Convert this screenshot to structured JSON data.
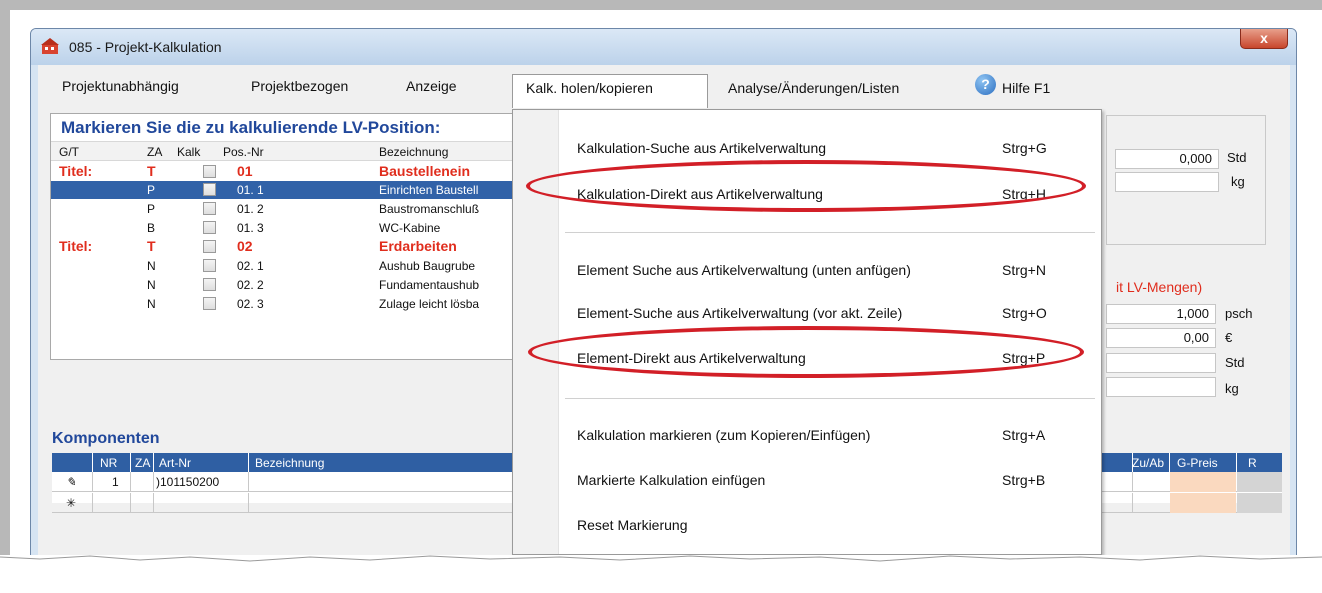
{
  "window": {
    "title": "085  -  Projekt-Kalkulation",
    "close_label": "x"
  },
  "menubar": {
    "items": [
      {
        "label": "Projektunabhängig"
      },
      {
        "label": "Projektbezogen"
      },
      {
        "label": "Anzeige"
      },
      {
        "label": "Kalk. holen/kopieren"
      },
      {
        "label": "Analyse/Änderungen/Listen"
      },
      {
        "label": "Hilfe F1"
      }
    ],
    "active_index": 3
  },
  "lv_panel": {
    "heading": "Markieren Sie die zu kalkulierende LV-Position:",
    "headers": [
      "G/T",
      "ZA",
      "Kalk",
      "Pos.-Nr",
      "Bezeichnung"
    ],
    "rows": [
      {
        "gt": "Titel:",
        "za": "T",
        "pos": "01",
        "bez": "Baustellenein",
        "title": true
      },
      {
        "gt": "",
        "za": "P",
        "pos": "01. 1",
        "bez": "Einrichten Baustell",
        "selected": true
      },
      {
        "gt": "",
        "za": "P",
        "pos": "01. 2",
        "bez": "Baustromanschluß"
      },
      {
        "gt": "",
        "za": "B",
        "pos": "01. 3",
        "bez": "WC-Kabine"
      },
      {
        "gt": "Titel:",
        "za": "T",
        "pos": "02",
        "bez": "Erdarbeiten",
        "title": true
      },
      {
        "gt": "",
        "za": "N",
        "pos": "02. 1",
        "bez": "Aushub Baugrube"
      },
      {
        "gt": "",
        "za": "N",
        "pos": "02. 2",
        "bez": "Fundamentaushub"
      },
      {
        "gt": "",
        "za": "N",
        "pos": "02. 3",
        "bez": "Zulage leicht lösba"
      }
    ]
  },
  "right_panel": {
    "std_value": "0,000",
    "std_unit": "Std",
    "kg_unit": "kg",
    "lv_mengen_label": "it LV-Mengen)",
    "qty_value": "1,000",
    "qty_unit": "psch",
    "price_value": "0,00",
    "price_unit": "€",
    "std_unit2": "Std",
    "kg_unit2": "kg"
  },
  "komponenten": {
    "heading": "Komponenten",
    "headers": [
      "NR",
      "ZA",
      "Art-Nr",
      "Bezeichnung",
      "Zu/Ab",
      "G-Preis",
      "R"
    ],
    "rows": [
      {
        "marker": "pencil",
        "nr": "1",
        "artnr": ")101150200"
      },
      {
        "marker": "asterisk",
        "symbol": "✳"
      }
    ]
  },
  "dropdown": {
    "items": [
      {
        "label": "Kalkulation-Suche aus Artikelverwaltung",
        "shortcut": "Strg+G"
      },
      {
        "label": "Kalkulation-Direkt aus Artikelverwaltung",
        "shortcut": "Strg+H",
        "highlighted": true
      },
      {
        "label": "Element Suche aus Artikelverwaltung (unten anfügen)",
        "shortcut": "Strg+N"
      },
      {
        "label": "Element-Suche aus Artikelverwaltung (vor akt. Zeile)",
        "shortcut": "Strg+O"
      },
      {
        "label": "Element-Direkt aus Artikelverwaltung",
        "shortcut": "Strg+P",
        "highlighted": true
      },
      {
        "label": "Kalkulation markieren (zum Kopieren/Einfügen)",
        "shortcut": "Strg+A"
      },
      {
        "label": "Markierte Kalkulation einfügen",
        "shortcut": "Strg+B"
      },
      {
        "label": "Reset Markierung",
        "shortcut": ""
      }
    ]
  },
  "colors": {
    "accent_blue": "#21489b",
    "title_red": "#e02d1d",
    "highlight_ellipse": "#d21f27",
    "selected_row": "#3162a8",
    "gpreis_cell": "#fad9bf"
  }
}
